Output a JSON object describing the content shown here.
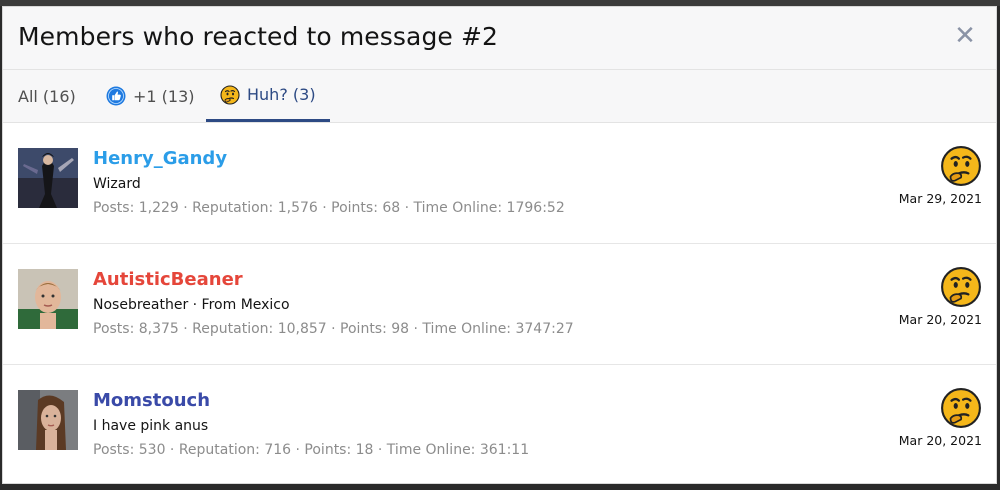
{
  "modal": {
    "title": "Members who reacted to message #2",
    "close_symbol": "✕"
  },
  "tabs": [
    {
      "label": "All (16)",
      "icon": null,
      "active": false
    },
    {
      "label": "+1 (13)",
      "icon": "thumbs-up-icon",
      "active": false
    },
    {
      "label": "Huh? (3)",
      "icon": "thinking-face-icon",
      "active": true
    }
  ],
  "members": [
    {
      "name": "Henry_Gandy",
      "name_color": "#2b9de8",
      "title": "Wizard",
      "stats": "Posts: 1,229 · Reputation: 1,576 · Points: 68 · Time Online: 1796:52",
      "reaction_icon": "thinking-face-icon",
      "date": "Mar 29, 2021"
    },
    {
      "name": "AutisticBeaner",
      "name_color": "#e5463a",
      "title": "Nosebreather · From Mexico",
      "stats": "Posts: 8,375 · Reputation: 10,857 · Points: 98 · Time Online: 3747:27",
      "reaction_icon": "thinking-face-icon",
      "date": "Mar 20, 2021"
    },
    {
      "name": "Momstouch",
      "name_color": "#3a4aa8",
      "title": "I have pink anus",
      "stats": "Posts: 530 · Reputation: 716 · Points: 18 · Time Online: 361:11",
      "reaction_icon": "thinking-face-icon",
      "date": "Mar 20, 2021"
    }
  ],
  "colors": {
    "accent": "#2d4a84",
    "muted_text": "#8c8c8c",
    "emoji_yellow": "#f5b71a"
  }
}
